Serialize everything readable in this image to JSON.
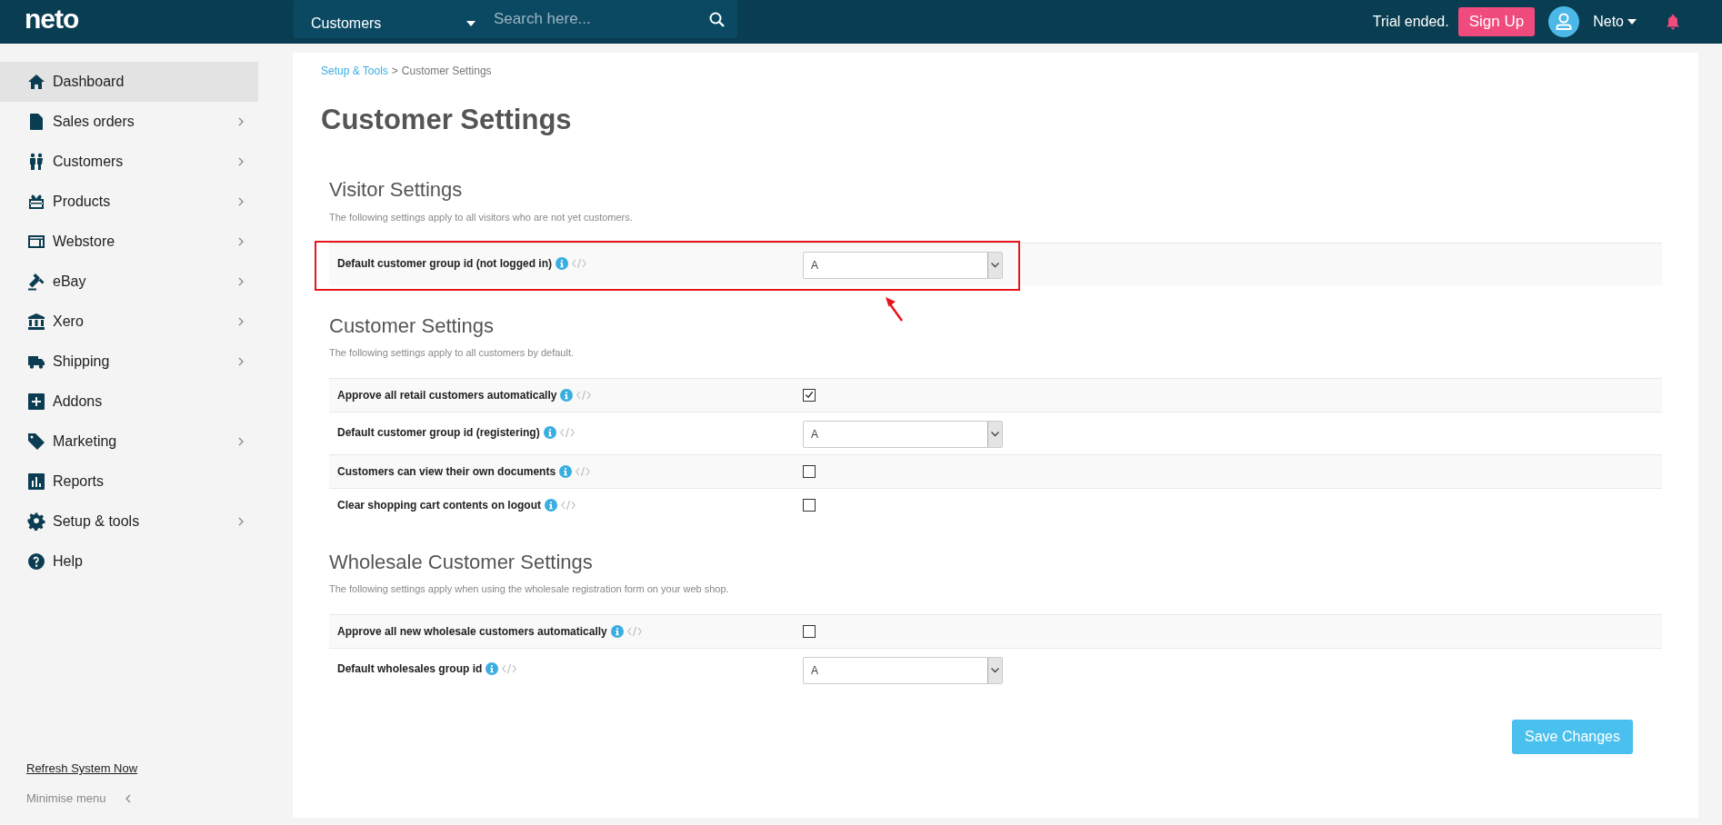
{
  "topbar": {
    "logo": "neto",
    "search_category": "Customers",
    "search": {
      "placeholder": "Search here..."
    },
    "trial_text": "Trial ended.",
    "signup_button": "Sign Up",
    "user_name": "Neto"
  },
  "sidebar": {
    "items": [
      {
        "label": "Dashboard",
        "selected": true,
        "expandable": false
      },
      {
        "label": "Sales orders",
        "selected": false,
        "expandable": true
      },
      {
        "label": "Customers",
        "selected": false,
        "expandable": true
      },
      {
        "label": "Products",
        "selected": false,
        "expandable": true
      },
      {
        "label": "Webstore",
        "selected": false,
        "expandable": true
      },
      {
        "label": "eBay",
        "selected": false,
        "expandable": true
      },
      {
        "label": "Xero",
        "selected": false,
        "expandable": true
      },
      {
        "label": "Shipping",
        "selected": false,
        "expandable": true
      },
      {
        "label": "Addons",
        "selected": false,
        "expandable": false
      },
      {
        "label": "Marketing",
        "selected": false,
        "expandable": true
      },
      {
        "label": "Reports",
        "selected": false,
        "expandable": false
      },
      {
        "label": "Setup & tools",
        "selected": false,
        "expandable": true
      },
      {
        "label": "Help",
        "selected": false,
        "expandable": false
      }
    ],
    "refresh_link": "Refresh System Now",
    "minimise_label": "Minimise menu"
  },
  "breadcrumb": {
    "link": "Setup & Tools",
    "separator": ">",
    "current": "Customer Settings"
  },
  "title": "Customer Settings",
  "sections": [
    {
      "heading": "Visitor Settings",
      "description": "The following settings apply to all visitors who are not yet customers.",
      "settings": [
        {
          "label": "Default customer group id (not logged in)",
          "kind": "select",
          "value": "A",
          "highlighted": true
        }
      ]
    },
    {
      "heading": "Customer Settings",
      "description": "The following settings apply to all customers by default.",
      "settings": [
        {
          "label": "Approve all retail customers automatically",
          "kind": "checkbox",
          "checked": true,
          "highlighted": false
        },
        {
          "label": "Default customer group id (registering)",
          "kind": "select",
          "value": "A",
          "highlighted": false
        },
        {
          "label": "Customers can view their own documents",
          "kind": "checkbox",
          "checked": false,
          "highlighted": false
        },
        {
          "label": "Clear shopping cart contents on logout",
          "kind": "checkbox",
          "checked": false,
          "highlighted": false
        }
      ]
    },
    {
      "heading": "Wholesale Customer Settings",
      "description": "The following settings apply when using the wholesale registration form on your web shop.",
      "settings": [
        {
          "label": "Approve all new wholesale customers automatically",
          "kind": "checkbox",
          "checked": false,
          "highlighted": false
        },
        {
          "label": "Default wholesales group id",
          "kind": "select",
          "value": "A",
          "highlighted": false
        }
      ]
    }
  ],
  "save_button": "Save Changes"
}
